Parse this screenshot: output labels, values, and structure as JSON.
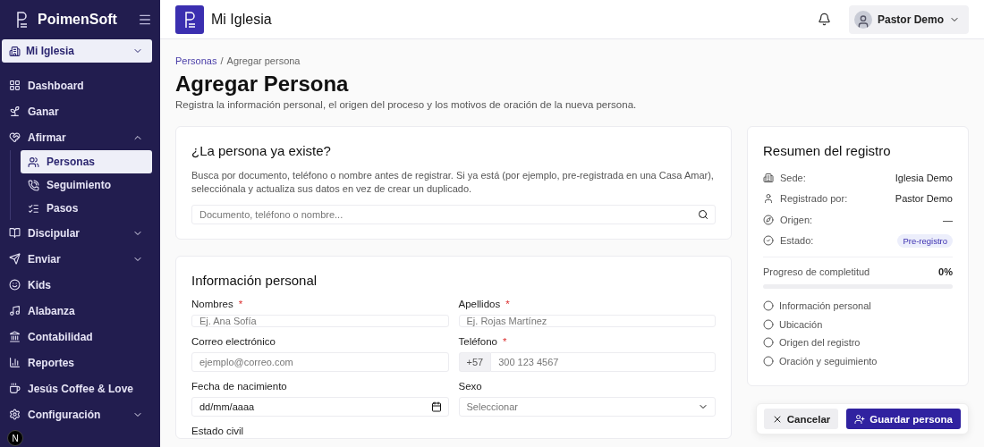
{
  "sidebar": {
    "brand": "PoimenSoft",
    "church_selector": "Mi Iglesia",
    "items": [
      {
        "label": "Dashboard",
        "kind": "link",
        "selected": false
      },
      {
        "label": "Ganar",
        "kind": "link",
        "selected": false
      },
      {
        "label": "Afirmar",
        "kind": "group",
        "selected": false,
        "expanded": true,
        "children": [
          {
            "label": "Personas",
            "selected": true
          },
          {
            "label": "Seguimiento",
            "selected": false
          },
          {
            "label": "Pasos",
            "selected": false
          }
        ]
      },
      {
        "label": "Discipular",
        "kind": "group",
        "selected": false,
        "expanded": false
      },
      {
        "label": "Enviar",
        "kind": "group",
        "selected": false,
        "expanded": false
      },
      {
        "label": "Kids",
        "kind": "link",
        "selected": false
      },
      {
        "label": "Alabanza",
        "kind": "link",
        "selected": false
      },
      {
        "label": "Contabilidad",
        "kind": "link",
        "selected": false
      },
      {
        "label": "Reportes",
        "kind": "link",
        "selected": false
      },
      {
        "label": "Jesús Coffee & Love",
        "kind": "link",
        "selected": false
      },
      {
        "label": "Configuración",
        "kind": "group",
        "selected": false,
        "expanded": false
      }
    ]
  },
  "header": {
    "title": "Mi Iglesia",
    "user": "Pastor Demo"
  },
  "breadcrumb": {
    "items": [
      {
        "label": "Personas",
        "kind": "link"
      },
      {
        "label": "Agregar persona",
        "kind": "current"
      }
    ],
    "separator": "/"
  },
  "page": {
    "title": "Agregar Persona",
    "subtitle": "Registra la información personal, el origen del proceso y los motivos de oración de la nueva persona."
  },
  "search_card": {
    "title": "¿La persona ya existe?",
    "description": "Busca por documento, teléfono o nombre antes de registrar. Si ya está (por ejemplo, pre-registrada en una Casa Amar), selecciónala y actualiza sus datos en vez de crear un duplicado.",
    "placeholder": "Documento, teléfono o nombre..."
  },
  "personal_info": {
    "title": "Información personal",
    "required_mark": "*",
    "fields": [
      {
        "label": "Nombres",
        "required": true,
        "kind": "text",
        "placeholder": "Ej. Ana Sofía"
      },
      {
        "label": "Apellidos",
        "required": true,
        "kind": "text",
        "placeholder": "Ej. Rojas Martínez"
      },
      {
        "label": "Correo electrónico",
        "required": false,
        "kind": "text",
        "placeholder": "ejemplo@correo.com"
      },
      {
        "label": "Teléfono",
        "required": true,
        "kind": "phone",
        "prefix": "+57",
        "placeholder": "300 123 4567"
      },
      {
        "label": "Fecha de nacimiento",
        "required": false,
        "kind": "date",
        "placeholder": "dd/mm/aaaa"
      },
      {
        "label": "Sexo",
        "required": false,
        "kind": "select",
        "placeholder": "Seleccionar"
      },
      {
        "label": "Estado civil",
        "required": false,
        "kind": "label"
      }
    ]
  },
  "summary": {
    "title": "Resumen del registro",
    "rows": [
      {
        "label": "Sede:",
        "value": "Iglesia Demo",
        "kind": "text"
      },
      {
        "label": "Registrado por:",
        "value": "Pastor Demo",
        "kind": "text"
      },
      {
        "label": "Origen:",
        "value": "—",
        "kind": "text"
      },
      {
        "label": "Estado:",
        "value": "Pre-registro",
        "kind": "badge"
      }
    ],
    "progress": {
      "label": "Progreso de completitud",
      "reading": "0%",
      "level": 0
    },
    "checklist": [
      {
        "label": "Información personal",
        "checked": false
      },
      {
        "label": "Ubicación",
        "checked": false
      },
      {
        "label": "Origen del registro",
        "checked": false
      },
      {
        "label": "Oración y seguimiento",
        "checked": false
      }
    ]
  },
  "actions": [
    {
      "label": "Cancelar",
      "kind": "secondary"
    },
    {
      "label": "Guardar persona",
      "kind": "primary"
    }
  ],
  "dev_badge": "N"
}
